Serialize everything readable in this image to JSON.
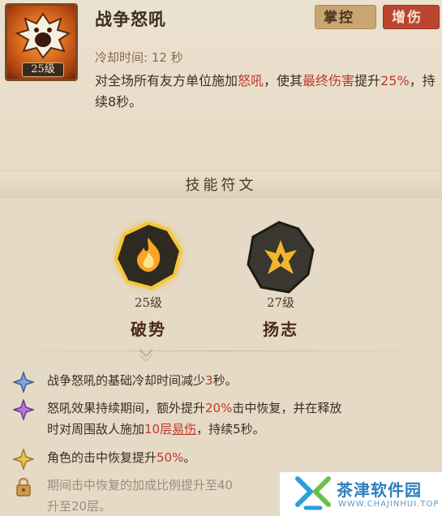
{
  "skill": {
    "title": "战争怒吼",
    "level": "25级",
    "tags": [
      "掌控",
      "增伤"
    ],
    "cooldown": "冷却时间: 12 秒",
    "desc_parts": {
      "p1": "对全场所有友方单位施加",
      "p2": "怒吼",
      "p3": "，使其",
      "p4": "最终伤害",
      "p5": "提升",
      "p6": "25%",
      "p7": "，持续8秒。"
    }
  },
  "runes": {
    "header": "技能符文",
    "items": [
      {
        "level": "25级",
        "name": "破势",
        "icon": "flame-rune-icon",
        "selected": true
      },
      {
        "level": "27级",
        "name": "扬志",
        "icon": "spark-rune-icon",
        "selected": false
      }
    ]
  },
  "effects": [
    {
      "icon": "blue-star-icon",
      "parts": [
        "战争怒吼的基础冷却时间减少",
        "3",
        "秒。"
      ]
    },
    {
      "icon": "purple-star-icon",
      "line1": [
        "怒吼效果持续期间，额外提升",
        "20%",
        "击中恢复，并在释放"
      ],
      "line2": [
        "时对周围敌人施加",
        "10层",
        "易伤",
        "，持续5秒。"
      ]
    },
    {
      "icon": "gold-star-icon",
      "parts": [
        "角色的击中恢复提升",
        "50%",
        "。"
      ]
    },
    {
      "icon": "lock-icon",
      "line1": "期间击中恢复的加成比例提升至40",
      "line2": "升至20层。"
    }
  ],
  "watermark": {
    "title": "茶津软件园",
    "url": "WWW.CHAJINHUI.TOP"
  },
  "colors": {
    "accent_red": "#c0392b",
    "tag_control": "#c9a671",
    "tag_damage": "#bb4431",
    "background": "#e5dac6"
  }
}
